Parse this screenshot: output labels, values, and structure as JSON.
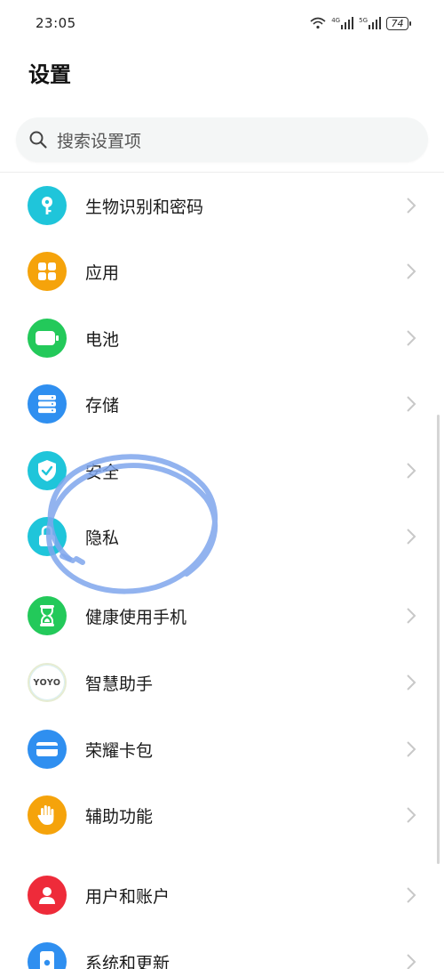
{
  "status_bar": {
    "time": "23:05",
    "network_1": "4G",
    "network_2": "5G",
    "battery": "74"
  },
  "page_title": "设置",
  "search": {
    "placeholder": "搜索设置项"
  },
  "items": [
    {
      "label": "生物识别和密码",
      "icon": "key-icon",
      "color": "#1fc5da"
    },
    {
      "label": "应用",
      "icon": "apps-grid-icon",
      "color": "#f5a30b"
    },
    {
      "label": "电池",
      "icon": "battery-icon",
      "color": "#23c95a"
    },
    {
      "label": "存储",
      "icon": "storage-icon",
      "color": "#2f8ff0"
    },
    {
      "label": "安全",
      "icon": "shield-check-icon",
      "color": "#1fc5da"
    },
    {
      "label": "隐私",
      "icon": "privacy-lock-icon",
      "color": "#1fc5da"
    },
    {
      "label": "健康使用手机",
      "icon": "hourglass-icon",
      "color": "#23c95a"
    },
    {
      "label": "智慧助手",
      "icon": "yoyo-icon",
      "color": "#ffffff",
      "icon_text": "YOYO"
    },
    {
      "label": "荣耀卡包",
      "icon": "wallet-card-icon",
      "color": "#2f8ff0"
    },
    {
      "label": "辅助功能",
      "icon": "hand-icon",
      "color": "#f5a30b"
    },
    {
      "label": "用户和账户",
      "icon": "user-icon",
      "color": "#ee2b3a"
    },
    {
      "label": "系统和更新",
      "icon": "system-update-icon",
      "color": "#2f8ff0"
    }
  ],
  "colors": {
    "annotation_stroke": "#7fa6ec",
    "chevron": "#c8c8c8",
    "search_bg": "#f4f6f6"
  }
}
